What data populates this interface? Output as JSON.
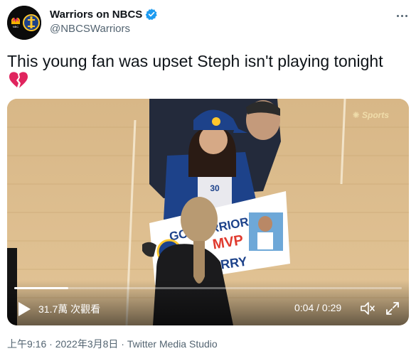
{
  "author": {
    "display_name": "Warriors on NBCS",
    "handle": "@NBCSWarriors",
    "verified": true
  },
  "tweet": {
    "text": "This young fan was upset Steph isn't playing tonight",
    "emoji": "broken-heart-icon"
  },
  "video": {
    "views": "31.7萬 次觀看",
    "time": "0:04 / 0:29",
    "progress": 0.14,
    "watermark": "Sports",
    "sign_lines": [
      "GO WARRIORS!",
      "MVP",
      "CURRY"
    ]
  },
  "meta": {
    "timestamp": "上午9:16 · 2022年3月8日 · Twitter Media Studio"
  },
  "colors": {
    "verified": "#1d9bf0",
    "text_secondary": "#536471",
    "warriors_blue": "#1d428a",
    "warriors_gold": "#ffc72c",
    "broken_heart": "#e0245e"
  }
}
